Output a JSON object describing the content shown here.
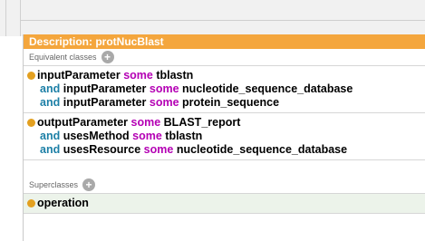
{
  "header": {
    "title": "Description: protNucBlast"
  },
  "equivalent": {
    "label": "Equivalent classes",
    "add_icon": "add-icon",
    "axioms": [
      {
        "lines": [
          {
            "conn": "",
            "prop": "inputParameter",
            "kw": "some",
            "cls": "tblastn"
          },
          {
            "conn": "and",
            "prop": "inputParameter",
            "kw": "some",
            "cls": "nucleotide_sequence_database"
          },
          {
            "conn": "and",
            "prop": "inputParameter",
            "kw": "some",
            "cls": "protein_sequence"
          }
        ]
      },
      {
        "lines": [
          {
            "conn": "",
            "prop": "outputParameter",
            "kw": "some",
            "cls": "BLAST_report"
          },
          {
            "conn": "and",
            "prop": "usesMethod",
            "kw": "some",
            "cls": "tblastn"
          },
          {
            "conn": "and",
            "prop": "usesResource",
            "kw": "some",
            "cls": "nucleotide_sequence_database"
          }
        ]
      }
    ]
  },
  "superclasses": {
    "label": "Superclasses",
    "add_icon": "add-icon",
    "items": [
      {
        "name": "operation"
      }
    ]
  },
  "colors": {
    "header": "#f4a63d",
    "keyword": "#b400b4",
    "connective": "#1c7fa6",
    "bullet": "#e3a020"
  }
}
